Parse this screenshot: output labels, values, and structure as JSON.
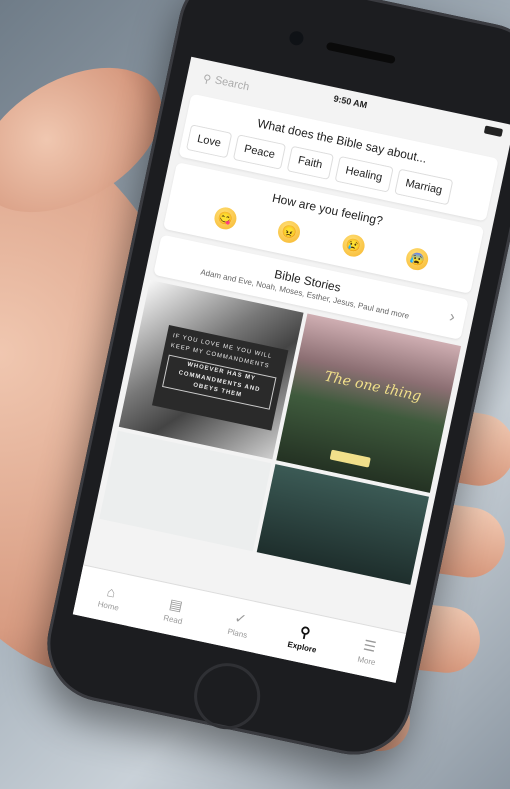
{
  "status_bar": {
    "time": "9:50 AM"
  },
  "search": {
    "placeholder": "Search"
  },
  "topics": {
    "title": "What does the Bible say about...",
    "chips": [
      "Love",
      "Peace",
      "Faith",
      "Healing",
      "Marriag"
    ]
  },
  "feelings": {
    "title": "How are you feeling?",
    "emojis": [
      "😋",
      "😠",
      "😢",
      "😰"
    ]
  },
  "stories": {
    "title": "Bible Stories",
    "subtitle": "Adam and Eve, Noah, Moses, Esther, Jesus, Paul and more"
  },
  "tiles": {
    "tile1_text": "If you love me you will keep my commandments",
    "tile1_emph": "Whoever has my commandments and obeys them",
    "tile2_heading": "The one thing",
    "tile2_body": "",
    "tile3_text": "",
    "tile4_text": ""
  },
  "tabbar": {
    "items": [
      {
        "label": "Home",
        "icon": "home-icon",
        "active": false
      },
      {
        "label": "Read",
        "icon": "book-icon",
        "active": false
      },
      {
        "label": "Plans",
        "icon": "check-icon",
        "active": false
      },
      {
        "label": "Explore",
        "icon": "search-icon",
        "active": true
      },
      {
        "label": "More",
        "icon": "menu-icon",
        "active": false
      }
    ]
  },
  "colors": {
    "accent": "#111111",
    "inactive": "#999999",
    "screen_bg": "#f3f3f3"
  }
}
